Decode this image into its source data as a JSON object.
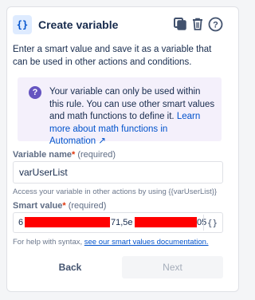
{
  "header": {
    "icon_glyph": "{}",
    "title": "Create variable",
    "icons": [
      "copy-icon",
      "trash-icon",
      "help-icon"
    ]
  },
  "description": "Enter a smart value and save it as a variable that can be used in other actions and conditions.",
  "info": {
    "icon": "question-circle-icon",
    "text": "Your variable can only be used within this rule. You can use other smart values and math functions to define it. ",
    "link": "Learn more about math functions in Automation ↗"
  },
  "variable_name": {
    "label": "Variable name",
    "required_mark": "*",
    "required_text": " (required)",
    "value": "varUserList",
    "helper": "Access your variable in other actions by using {{varUserList}}"
  },
  "smart_value": {
    "label": "Smart value",
    "required_mark": "*",
    "required_text": " (required)",
    "segments": [
      "6",
      "71,5e",
      "05"
    ],
    "button_glyph": "{}",
    "helper_prefix": "For help with syntax, ",
    "helper_link": "see our smart values documentation."
  },
  "footer": {
    "back_label": "Back",
    "next_label": "Next"
  },
  "colors": {
    "accent": "#0052cc",
    "info_bg": "#f4f0fb",
    "info_icon": "#6554c0",
    "required": "#de350b",
    "redaction": "#ff0000"
  }
}
